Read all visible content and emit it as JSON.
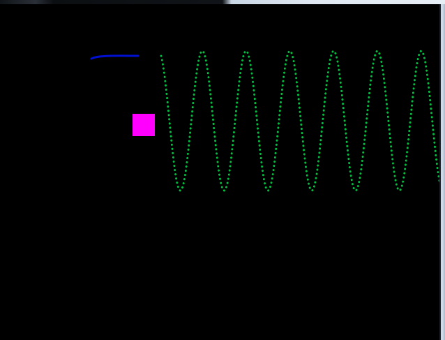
{
  "window": {
    "title": ""
  },
  "scene": {
    "background_color": "#000000",
    "paddle": {
      "color": "#0010d0"
    },
    "player_square": {
      "color": "#ff00ff"
    },
    "wave": {
      "color": "#00c040",
      "style": "dotted",
      "cycles": 6
    }
  }
}
